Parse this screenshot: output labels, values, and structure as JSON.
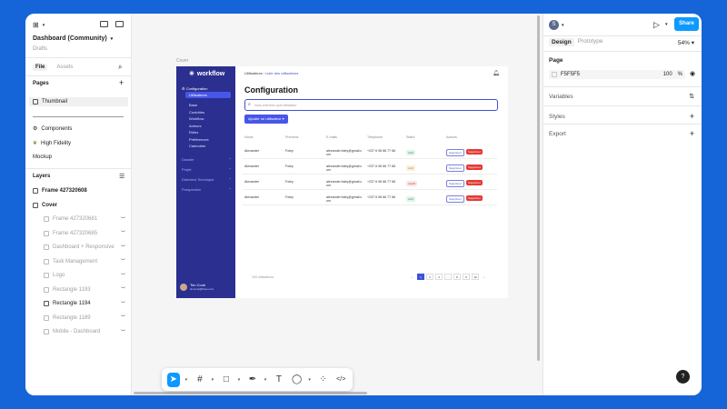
{
  "left_panel": {
    "file_title": "Dashboard (Community)",
    "file_location": "Drafts",
    "tabs": [
      "File",
      "Assets"
    ],
    "pages_heading": "Pages",
    "pages": [
      "Thumbnail",
      "Components",
      "High Fidelity",
      "Mockup"
    ],
    "layers_heading": "Layers",
    "layers": [
      {
        "label": "Frame 427320608",
        "dim": false
      },
      {
        "label": "Cover",
        "dim": false
      },
      {
        "label": "Frame 427320681",
        "dim": true
      },
      {
        "label": "Frame 427320685",
        "dim": true
      },
      {
        "label": "Dashboard + Responsive",
        "dim": true
      },
      {
        "label": "Task Management",
        "dim": true
      },
      {
        "label": "Logo",
        "dim": true
      },
      {
        "label": "Rectangle 1193",
        "dim": true
      },
      {
        "label": "Rectangle 1194",
        "dim": false
      },
      {
        "label": "Rectangle 1189",
        "dim": true
      },
      {
        "label": "Mobile - Dashboard",
        "dim": true
      }
    ]
  },
  "canvas": {
    "frame_label": "Cover",
    "app": {
      "brand": "workflow",
      "breadcrumb_root": "Utilisateurs",
      "breadcrumb_current": "Liste des utilisateurs",
      "title": "Configuration",
      "search_placeholder": "Vous cherchez quel utilisateur",
      "add_button": "Ajouter un utilisateur",
      "sidebar": {
        "section": "Configuration",
        "active": "Utilisateurs",
        "sub_items": [
          "Base",
          "Contrôles",
          "Workflow",
          "Acteurs",
          "Rôles",
          "Préférences",
          "Calendrier"
        ],
        "groups": [
          "Dossier",
          "Projet",
          "Directeur Technique",
          "Prospection"
        ]
      },
      "user_name": "Tim Cook",
      "user_email": "timcook@fluxe.com",
      "columns": [
        "Noms",
        "Prénoms",
        "E-mails",
        "Téléphone",
        "Statut",
        "Actions"
      ],
      "rows": [
        {
          "nom": "Alexander",
          "prenom": "Foley",
          "email": "alexander.foley@gmail.com",
          "tel": "+237 6 96 66 77 66",
          "status": "Actif",
          "status_color": "#2e9e5b"
        },
        {
          "nom": "Alexander",
          "prenom": "Foley",
          "email": "alexander.foley@gmail.com",
          "tel": "+237 6 96 66 77 66",
          "status": "Actif",
          "status_color": "#c98a00"
        },
        {
          "nom": "Alexander",
          "prenom": "Foley",
          "email": "alexander.foley@gmail.com",
          "tel": "+237 6 96 66 77 66",
          "status": "Inactif",
          "status_color": "#d64040"
        },
        {
          "nom": "Alexander",
          "prenom": "Foley",
          "email": "alexander.foley@gmail.com",
          "tel": "+237 6 96 66 77 66",
          "status": "Actif",
          "status_color": "#2e9e5b"
        }
      ],
      "row_action_edit": "Supprimer",
      "row_action_delete": "Supprimer",
      "total": "100 utilisateurs",
      "pages": [
        "1",
        "2",
        "3",
        "...",
        "8",
        "9",
        "10"
      ]
    }
  },
  "right_panel": {
    "avatar_letter": "S",
    "share_label": "Share",
    "tabs": [
      "Design",
      "Prototype"
    ],
    "zoom": "54%",
    "page_heading": "Page",
    "page_color": "F5F5F5",
    "opacity": "100",
    "opacity_unit": "%",
    "sections": [
      "Variables",
      "Styles",
      "Export"
    ]
  },
  "help_label": "?",
  "colors": {
    "accent": "#0d99ff",
    "sidebar": "#2b2f8f",
    "background": "#1565d8"
  }
}
